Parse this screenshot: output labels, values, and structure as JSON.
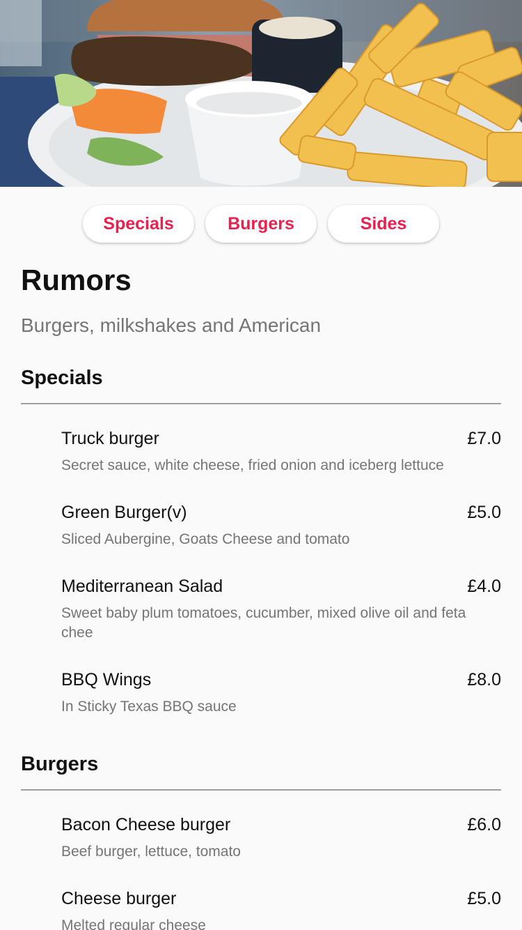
{
  "hero": {
    "image_icon": "burger-and-fries-photo"
  },
  "tabs": [
    {
      "label": "Specials"
    },
    {
      "label": "Burgers"
    },
    {
      "label": "Sides"
    }
  ],
  "restaurant": {
    "name": "Rumors",
    "tagline": "Burgers, milkshakes and American"
  },
  "sections": [
    {
      "title": "Specials",
      "items": [
        {
          "name": "Truck burger",
          "price": "£7.0",
          "description": "Secret sauce, white cheese, fried onion and iceberg lettuce"
        },
        {
          "name": "Green Burger(v)",
          "price": "£5.0",
          "description": "Sliced Aubergine, Goats Cheese and tomato"
        },
        {
          "name": "Mediterranean Salad",
          "price": "£4.0",
          "description": "Sweet baby plum tomatoes, cucumber, mixed olive oil and feta chee"
        },
        {
          "name": "BBQ Wings",
          "price": "£8.0",
          "description": "In Sticky Texas BBQ sauce"
        }
      ]
    },
    {
      "title": "Burgers",
      "items": [
        {
          "name": "Bacon Cheese burger",
          "price": "£6.0",
          "description": "Beef burger, lettuce, tomato"
        },
        {
          "name": "Cheese burger",
          "price": "£5.0",
          "description": "Melted regular cheese"
        }
      ]
    }
  ],
  "colors": {
    "accent": "#e8214e",
    "text_primary": "#111111",
    "text_secondary": "#757575",
    "background": "#fafafa"
  }
}
